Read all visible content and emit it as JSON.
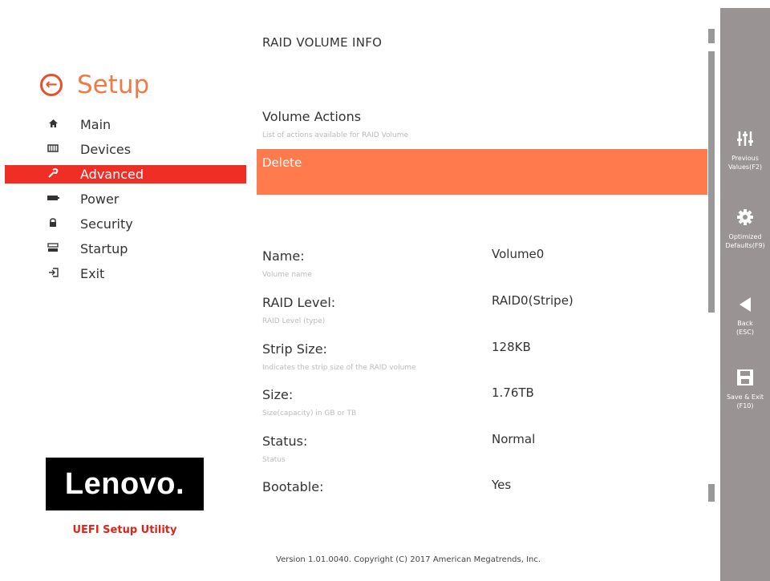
{
  "sidebar": {
    "title": "Setup",
    "items": [
      {
        "label": "Main",
        "icon": "home-icon"
      },
      {
        "label": "Devices",
        "icon": "devices-icon"
      },
      {
        "label": "Advanced",
        "icon": "wrench-icon",
        "active": true
      },
      {
        "label": "Power",
        "icon": "battery-icon"
      },
      {
        "label": "Security",
        "icon": "lock-icon"
      },
      {
        "label": "Startup",
        "icon": "startup-icon"
      },
      {
        "label": "Exit",
        "icon": "exit-icon"
      }
    ],
    "logo_text": "Lenovo.",
    "utility_text": "UEFI Setup Utility"
  },
  "main": {
    "page_title": "RAID VOLUME INFO",
    "section_title": "Volume Actions",
    "section_help": "List of actions available for RAID Volume",
    "action_label": "Delete",
    "rows": [
      {
        "label": "Name:",
        "help": "Volume name",
        "value": "Volume0"
      },
      {
        "label": "RAID Level:",
        "help": "RAID Level (type)",
        "value": "RAID0(Stripe)"
      },
      {
        "label": "Strip Size:",
        "help": "Indicates the strip size of the RAID volume",
        "value": "128KB"
      },
      {
        "label": "Size:",
        "help": "Size(capacity) in GB or TB",
        "value": "1.76TB"
      },
      {
        "label": "Status:",
        "help": "Status",
        "value": "Normal"
      },
      {
        "label": "Bootable:",
        "help": "",
        "value": "Yes"
      }
    ]
  },
  "footer": "Version 1.01.0040. Copyright (C) 2017 American Megatrends, Inc.",
  "rightbar": [
    {
      "label1": "Previous",
      "label2": "Values(F2)",
      "icon": "sliders-icon"
    },
    {
      "label1": "Optimized",
      "label2": "Defaults(F9)",
      "icon": "gear-icon"
    },
    {
      "label1": "Back",
      "label2": "(ESC)",
      "icon": "back-arrow-icon"
    },
    {
      "label1": "Save & Exit",
      "label2": "(F10)",
      "icon": "save-icon"
    }
  ],
  "colors": {
    "accent": "#f07a45",
    "active_nav": "#ef2f26",
    "action_bar": "#ff7a4d",
    "rightbar": "#9a9393",
    "utility_text": "#e0241a"
  }
}
